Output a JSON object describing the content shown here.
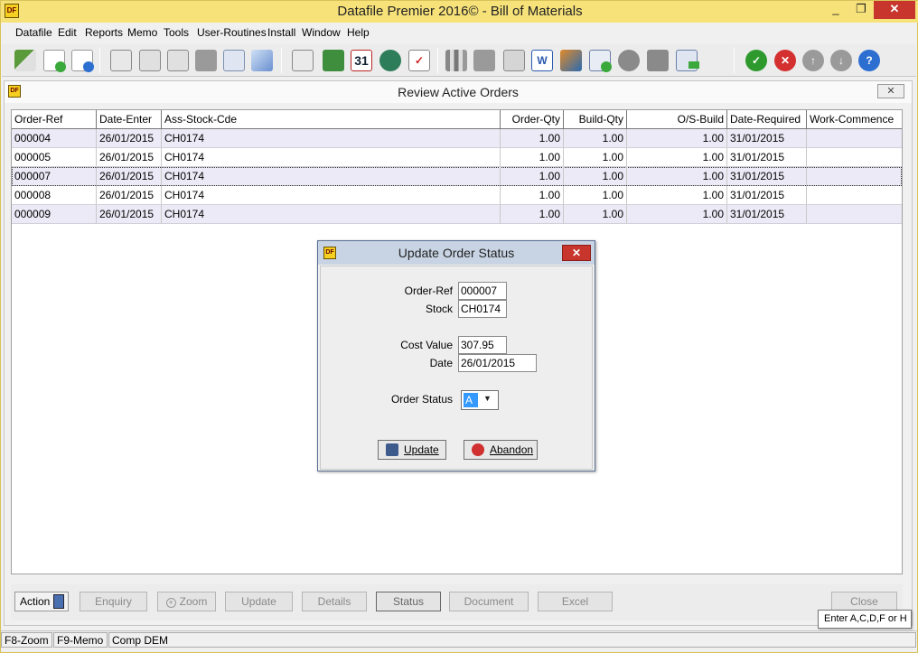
{
  "app": {
    "title": "Datafile  Premier 2016© - Bill of Materials",
    "logo_text": "DF"
  },
  "window_controls": {
    "minimize": "_",
    "restore": "❐",
    "close": "✕"
  },
  "menu": [
    "Datafile",
    "Edit",
    "Reports",
    "Memo",
    "Tools",
    "User-Routines",
    "Install",
    "Window",
    "Help"
  ],
  "toolbar_icons": [
    "cut-icon",
    "add-record-icon",
    "record-info-icon",
    "search-record-icon",
    "add-card-icon",
    "remove-card-icon",
    "package-icon",
    "info-icon",
    "eraser-icon",
    "lock-document-icon",
    "calculator-icon",
    "calendar-icon",
    "database-search-icon",
    "checklist-icon",
    "bar-chart-icon",
    "home-icon",
    "mail-icon",
    "word-document-icon",
    "picture-icon",
    "add-window-icon",
    "globe-icon",
    "printer-icon",
    "export-icon",
    "ok-icon",
    "cancel-icon",
    "up-icon",
    "down-icon",
    "help-icon"
  ],
  "child": {
    "title": "Review Active Orders",
    "close_label": "✕"
  },
  "grid": {
    "columns": [
      "Order-Ref",
      "Date-Enter",
      "Ass-Stock-Cde",
      "Order-Qty",
      "Build-Qty",
      "O/S-Build",
      "Date-Required",
      "Work-Commence"
    ],
    "rows": [
      [
        "000004",
        "26/01/2015",
        "CH0174",
        "1.00",
        "1.00",
        "1.00",
        "31/01/2015",
        ""
      ],
      [
        "000005",
        "26/01/2015",
        "CH0174",
        "1.00",
        "1.00",
        "1.00",
        "31/01/2015",
        ""
      ],
      [
        "000007",
        "26/01/2015",
        "CH0174",
        "1.00",
        "1.00",
        "1.00",
        "31/01/2015",
        ""
      ],
      [
        "000008",
        "26/01/2015",
        "CH0174",
        "1.00",
        "1.00",
        "1.00",
        "31/01/2015",
        ""
      ],
      [
        "000009",
        "26/01/2015",
        "CH0174",
        "1.00",
        "1.00",
        "1.00",
        "31/01/2015",
        ""
      ]
    ]
  },
  "actions": {
    "action": "Action",
    "enquiry": "Enquiry",
    "zoom": "Zoom",
    "update": "Update",
    "details": "Details",
    "status": "Status",
    "document": "Document",
    "excel": "Excel",
    "close": "Close"
  },
  "statusbar": {
    "f8": "F8-Zoom",
    "f9": "F9-Memo",
    "company": "Comp DEM"
  },
  "tooltip": "Enter A,C,D,F or H",
  "dialog": {
    "title": "Update Order Status",
    "close_label": "✕",
    "order_ref_label": "Order-Ref",
    "order_ref_value": "000007",
    "stock_label": "Stock",
    "stock_value": "CH0174",
    "cost_value_label": "Cost Value",
    "cost_value": "307.95",
    "date_label": "Date",
    "date_value": "26/01/2015",
    "order_status_label": "Order Status",
    "order_status_value": "A",
    "update_button": "Update",
    "abandon_button": "Abandon"
  }
}
